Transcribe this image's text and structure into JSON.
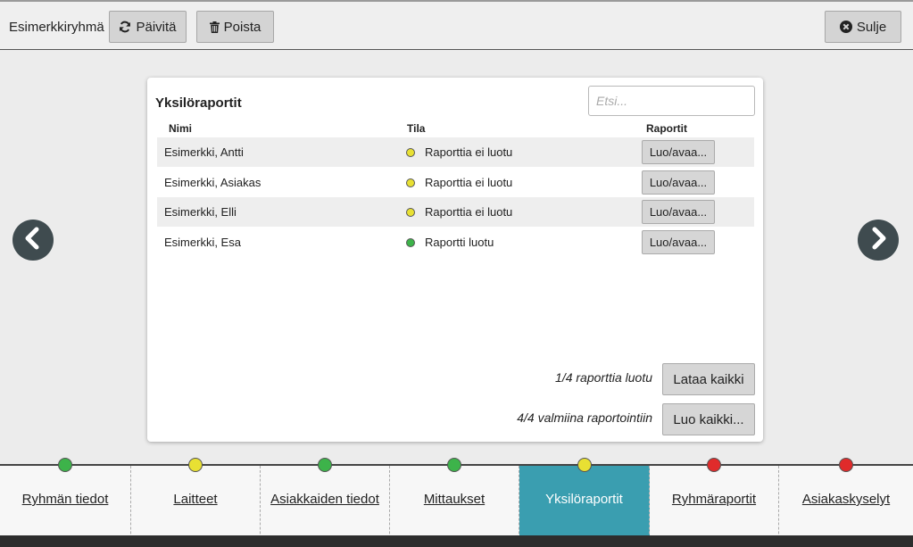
{
  "header": {
    "group_name": "Esimerkkiryhmä",
    "refresh_label": "Päivitä",
    "delete_label": "Poista",
    "close_label": "Sulje"
  },
  "panel": {
    "title": "Yksilöraportit",
    "search_placeholder": "Etsi...",
    "columns": {
      "name": "Nimi",
      "status": "Tila",
      "reports": "Raportit"
    },
    "rows": [
      {
        "name": "Esimerkki, Antti",
        "status": "Raporttia ei luotu",
        "status_color": "#e8e033",
        "action": "Luo/avaa..."
      },
      {
        "name": "Esimerkki, Asiakas",
        "status": "Raporttia ei luotu",
        "status_color": "#e8e033",
        "action": "Luo/avaa..."
      },
      {
        "name": "Esimerkki, Elli",
        "status": "Raporttia ei luotu",
        "status_color": "#e8e033",
        "action": "Luo/avaa..."
      },
      {
        "name": "Esimerkki, Esa",
        "status": "Raportti luotu",
        "status_color": "#3db34a",
        "action": "Luo/avaa..."
      }
    ],
    "footer": {
      "created_text": "1/4 raporttia luotu",
      "download_all_label": "Lataa kaikki",
      "ready_text": "4/4 valmiina raportointiin",
      "create_all_label": "Luo kaikki..."
    }
  },
  "tabs": [
    {
      "label": "Ryhmän tiedot",
      "dot_color": "#3db34a",
      "active": false
    },
    {
      "label": "Laitteet",
      "dot_color": "#e8e033",
      "active": false
    },
    {
      "label": "Asiakkaiden tiedot",
      "dot_color": "#3db34a",
      "active": false
    },
    {
      "label": "Mittaukset",
      "dot_color": "#3db34a",
      "active": false
    },
    {
      "label": "Yksilöraportit",
      "dot_color": "#e8e033",
      "active": true
    },
    {
      "label": "Ryhmäraportit",
      "dot_color": "#e02b2b",
      "active": false
    },
    {
      "label": "Asiakaskyselyt",
      "dot_color": "#e02b2b",
      "active": false
    }
  ],
  "icons": {
    "refresh": "refresh-icon",
    "delete": "trash-icon",
    "close": "close-circle-icon",
    "prev": "chevron-left-icon",
    "next": "chevron-right-icon"
  },
  "colors": {
    "active_tab": "#3a9eb0",
    "nav_arrow": "#3f4b4f"
  }
}
